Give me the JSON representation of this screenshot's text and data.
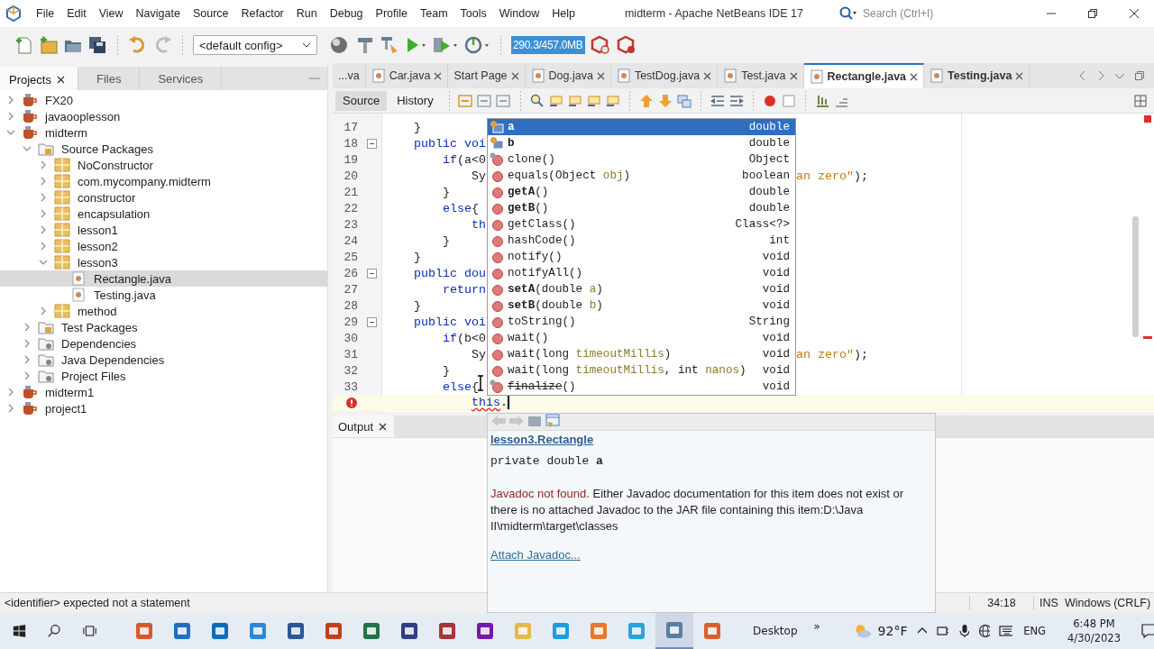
{
  "window": {
    "title": "midterm - Apache NetBeans IDE 17"
  },
  "menu": [
    "File",
    "Edit",
    "View",
    "Navigate",
    "Source",
    "Refactor",
    "Run",
    "Debug",
    "Profile",
    "Team",
    "Tools",
    "Window",
    "Help"
  ],
  "search": {
    "placeholder": "Search (Ctrl+I)"
  },
  "toolbar": {
    "config": "<default config>",
    "memory": "290.3/457.0MB"
  },
  "projects_panel": {
    "tabs": [
      {
        "label": "Projects",
        "selected": true
      },
      {
        "label": "Files",
        "selected": false
      },
      {
        "label": "Services",
        "selected": false
      }
    ],
    "tree": [
      {
        "label": "FX20",
        "kind": "project",
        "expanded": false,
        "selected": false
      },
      {
        "label": "javaooplesson",
        "kind": "project",
        "expanded": false,
        "selected": false
      },
      {
        "label": "midterm",
        "kind": "project",
        "expanded": true,
        "selected": false,
        "children": [
          {
            "label": "Source Packages",
            "kind": "source",
            "expanded": true,
            "selected": false,
            "children": [
              {
                "label": "NoConstructor",
                "kind": "package",
                "expanded": false,
                "selected": false
              },
              {
                "label": "com.mycompany.midterm",
                "kind": "package",
                "expanded": false,
                "selected": false
              },
              {
                "label": "constructor",
                "kind": "package",
                "expanded": false,
                "selected": false
              },
              {
                "label": "encapsulation",
                "kind": "package",
                "expanded": false,
                "selected": false
              },
              {
                "label": "lesson1",
                "kind": "package",
                "expanded": false,
                "selected": false
              },
              {
                "label": "lesson2",
                "kind": "package",
                "expanded": false,
                "selected": false
              },
              {
                "label": "lesson3",
                "kind": "package",
                "expanded": true,
                "selected": false,
                "children": [
                  {
                    "label": "Rectangle.java",
                    "kind": "file",
                    "selected": true
                  },
                  {
                    "label": "Testing.java",
                    "kind": "file",
                    "selected": false
                  }
                ]
              },
              {
                "label": "method",
                "kind": "package",
                "expanded": false,
                "selected": false
              }
            ]
          },
          {
            "label": "Test Packages",
            "kind": "source",
            "expanded": false,
            "selected": false
          },
          {
            "label": "Dependencies",
            "kind": "library",
            "expanded": false,
            "selected": false
          },
          {
            "label": "Java Dependencies",
            "kind": "library",
            "expanded": false,
            "selected": false
          },
          {
            "label": "Project Files",
            "kind": "settings",
            "expanded": false,
            "selected": false
          }
        ]
      },
      {
        "label": "midterm1",
        "kind": "project",
        "expanded": false,
        "selected": false
      },
      {
        "label": "project1",
        "kind": "project",
        "expanded": false,
        "selected": false
      }
    ]
  },
  "editor": {
    "tabs": [
      {
        "label": "...va",
        "kind": "cut",
        "selected": false,
        "modified": false
      },
      {
        "label": "Car.java",
        "kind": "java",
        "selected": false,
        "modified": false
      },
      {
        "label": "Start Page",
        "kind": "page",
        "selected": false,
        "modified": false
      },
      {
        "label": "Dog.java",
        "kind": "java",
        "selected": false,
        "modified": false
      },
      {
        "label": "TestDog.java",
        "kind": "java",
        "selected": false,
        "modified": false
      },
      {
        "label": "Test.java",
        "kind": "java",
        "selected": false,
        "modified": false
      },
      {
        "label": "Rectangle.java",
        "kind": "java",
        "selected": true,
        "modified": true
      },
      {
        "label": "Testing.java",
        "kind": "java",
        "selected": false,
        "modified": true
      }
    ],
    "views": [
      {
        "label": "Source",
        "selected": true
      },
      {
        "label": "History",
        "selected": false
      }
    ],
    "lines": [
      {
        "number": "17",
        "tokens": [
          {
            "text": "    }",
            "kind": "plain"
          }
        ]
      },
      {
        "number": "18",
        "fold": true,
        "tokens": [
          {
            "text": "    public voi",
            "kind": "keyword"
          }
        ]
      },
      {
        "number": "19",
        "tokens": [
          {
            "text": "        if",
            "kind": "keyword"
          },
          {
            "text": "(a<0",
            "kind": "plain"
          }
        ]
      },
      {
        "number": "20",
        "tokens": [
          {
            "text": "            Sy",
            "kind": "plain"
          }
        ],
        "right": [
          {
            "text": "an zero\"",
            "kind": "string"
          },
          {
            "text": ");",
            "kind": "plain"
          }
        ]
      },
      {
        "number": "21",
        "tokens": [
          {
            "text": "        }",
            "kind": "plain"
          }
        ]
      },
      {
        "number": "22",
        "tokens": [
          {
            "text": "        else",
            "kind": "keyword"
          },
          {
            "text": "{",
            "kind": "plain"
          }
        ]
      },
      {
        "number": "23",
        "tokens": [
          {
            "text": "            th",
            "kind": "keyword"
          }
        ]
      },
      {
        "number": "24",
        "tokens": [
          {
            "text": "        }",
            "kind": "plain"
          }
        ]
      },
      {
        "number": "25",
        "tokens": [
          {
            "text": "    }",
            "kind": "plain"
          }
        ]
      },
      {
        "number": "26",
        "fold": true,
        "tokens": [
          {
            "text": "    public dou",
            "kind": "keyword"
          }
        ]
      },
      {
        "number": "27",
        "tokens": [
          {
            "text": "        return",
            "kind": "keyword"
          }
        ]
      },
      {
        "number": "28",
        "tokens": [
          {
            "text": "    }",
            "kind": "plain"
          }
        ]
      },
      {
        "number": "29",
        "fold": true,
        "tokens": [
          {
            "text": "    public voi",
            "kind": "keyword"
          }
        ]
      },
      {
        "number": "30",
        "tokens": [
          {
            "text": "        if",
            "kind": "keyword"
          },
          {
            "text": "(b<0",
            "kind": "plain"
          }
        ]
      },
      {
        "number": "31",
        "tokens": [
          {
            "text": "            Sy",
            "kind": "plain"
          }
        ],
        "right": [
          {
            "text": "an zero\"",
            "kind": "string"
          },
          {
            "text": ");",
            "kind": "plain"
          }
        ]
      },
      {
        "number": "32",
        "tokens": [
          {
            "text": "        }",
            "kind": "plain"
          }
        ]
      },
      {
        "number": "33",
        "tokens": [
          {
            "text": "        else",
            "kind": "keyword"
          },
          {
            "text": "{",
            "kind": "plain"
          }
        ]
      },
      {
        "error": true,
        "current": true,
        "tokens": [
          {
            "text": "            this",
            "kind": "error"
          },
          {
            "text": ".",
            "kind": "plain"
          }
        ]
      }
    ]
  },
  "completion": {
    "items": [
      {
        "name": "a",
        "type": "double",
        "kind": "field",
        "bold": true,
        "deprecated": false,
        "selected": true
      },
      {
        "name": "b",
        "type": "double",
        "kind": "field",
        "bold": true,
        "deprecated": false,
        "selected": false
      },
      {
        "name": "clone",
        "args": "()",
        "type": "Object",
        "kind": "protected",
        "bold": false,
        "deprecated": false,
        "selected": false
      },
      {
        "name": "equals",
        "args": "(Object *obj*)",
        "type": "boolean",
        "kind": "method",
        "bold": false,
        "deprecated": false,
        "selected": false
      },
      {
        "name": "getA",
        "args": "()",
        "type": "double",
        "kind": "method",
        "bold": true,
        "deprecated": false,
        "selected": false
      },
      {
        "name": "getB",
        "args": "()",
        "type": "double",
        "kind": "method",
        "bold": true,
        "deprecated": false,
        "selected": false
      },
      {
        "name": "getClass",
        "args": "()",
        "type": "Class<?>",
        "kind": "method",
        "bold": false,
        "deprecated": false,
        "selected": false
      },
      {
        "name": "hashCode",
        "args": "()",
        "type": "int",
        "kind": "method",
        "bold": false,
        "deprecated": false,
        "selected": false
      },
      {
        "name": "notify",
        "args": "()",
        "type": "void",
        "kind": "method",
        "bold": false,
        "deprecated": false,
        "selected": false
      },
      {
        "name": "notifyAll",
        "args": "()",
        "type": "void",
        "kind": "method",
        "bold": false,
        "deprecated": false,
        "selected": false
      },
      {
        "name": "setA",
        "args": "(double *a*)",
        "type": "void",
        "kind": "method",
        "bold": true,
        "deprecated": false,
        "selected": false
      },
      {
        "name": "setB",
        "args": "(double *b*)",
        "type": "void",
        "kind": "method",
        "bold": true,
        "deprecated": false,
        "selected": false
      },
      {
        "name": "toString",
        "args": "()",
        "type": "String",
        "kind": "method",
        "bold": false,
        "deprecated": false,
        "selected": false
      },
      {
        "name": "wait",
        "args": "()",
        "type": "void",
        "kind": "method",
        "bold": false,
        "deprecated": false,
        "selected": false
      },
      {
        "name": "wait",
        "args": "(long *timeoutMillis*)",
        "type": "void",
        "kind": "method",
        "bold": false,
        "deprecated": false,
        "selected": false
      },
      {
        "name": "wait",
        "args": "(long *timeoutMillis*, int *nanos*)",
        "type": "void",
        "kind": "method",
        "bold": false,
        "deprecated": false,
        "selected": false
      },
      {
        "name": "finalize",
        "args": "()",
        "type": "void",
        "kind": "protected",
        "bold": false,
        "deprecated": true,
        "selected": false
      }
    ]
  },
  "javadoc": {
    "link": "lesson3.Rectangle",
    "signature": "private double **a**",
    "note": "Javadoc not found.",
    "message": "Either Javadoc documentation for this item does not exist or there is no attached Javadoc to the JAR file containing this item:D:\\Java II\\midterm\\target\\classes",
    "action": "Attach Javadoc..."
  },
  "output": {
    "tab": "Output"
  },
  "status_bar": {
    "message": "<identifier> expected  not a statement",
    "position": "34:18",
    "mode": "INS",
    "line_endings": "Windows (CRLF)"
  },
  "taskbar": {
    "desktop": "Desktop",
    "overflow": "»",
    "weather": "92°F",
    "language": "ENG",
    "time": "6:48 PM",
    "date": "4/30/2023"
  }
}
